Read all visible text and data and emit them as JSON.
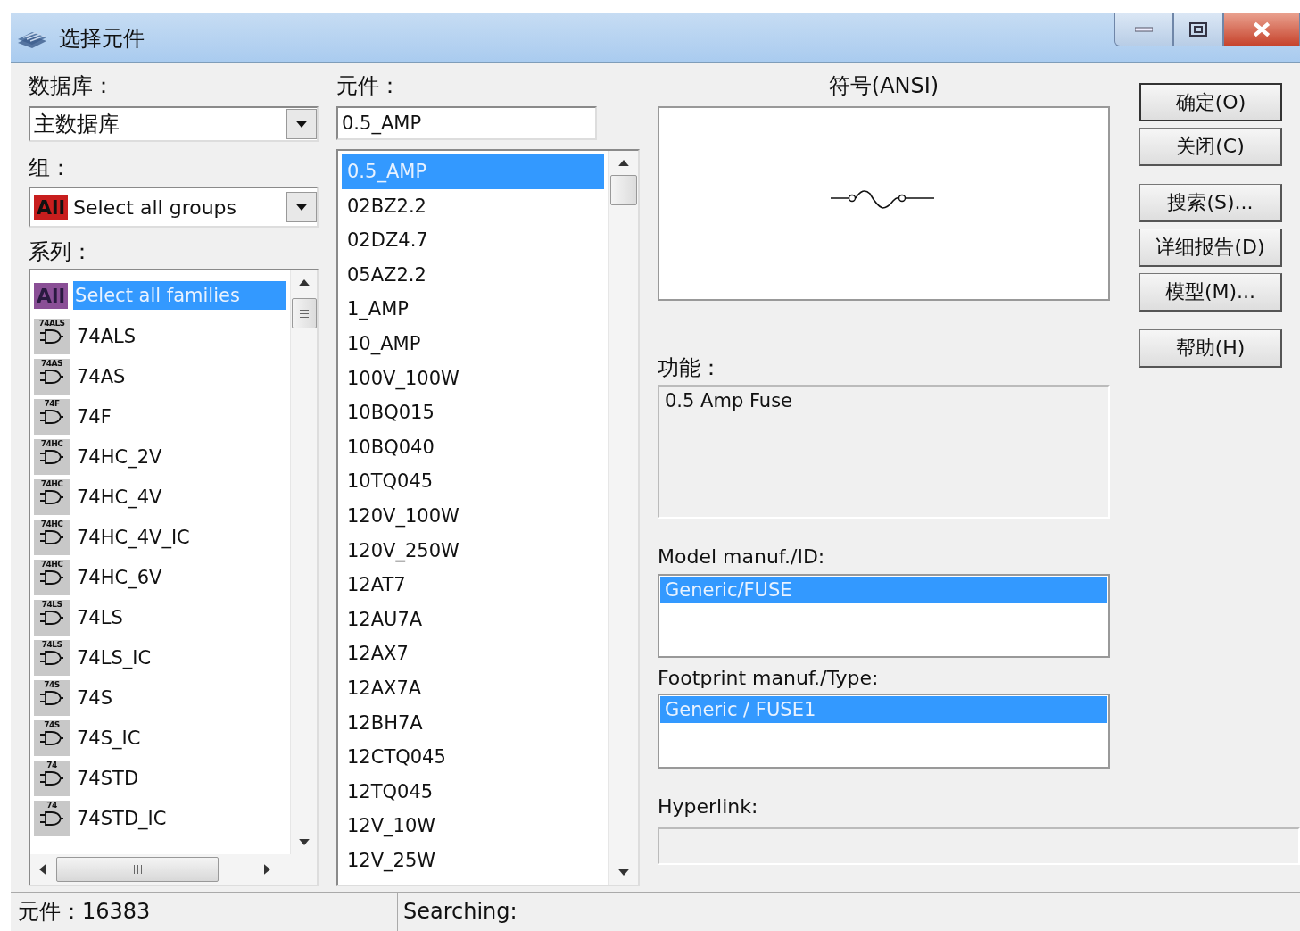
{
  "window": {
    "title": "选择元件"
  },
  "database": {
    "label": "数据库：",
    "value": "主数据库"
  },
  "group": {
    "label": "组：",
    "badge": "All",
    "value": "Select all groups"
  },
  "families": {
    "label": "系列：",
    "items": [
      {
        "kind": "all",
        "badge": "All",
        "name": "Select all families",
        "selected": true
      },
      {
        "kind": "gate",
        "icon_label": "74ALS",
        "name": "74ALS",
        "selected": false
      },
      {
        "kind": "gate",
        "icon_label": "74AS",
        "name": "74AS",
        "selected": false
      },
      {
        "kind": "gate",
        "icon_label": "74F",
        "name": "74F",
        "selected": false
      },
      {
        "kind": "gate",
        "icon_label": "74HC",
        "name": "74HC_2V",
        "selected": false
      },
      {
        "kind": "gate",
        "icon_label": "74HC",
        "name": "74HC_4V",
        "selected": false
      },
      {
        "kind": "gate",
        "icon_label": "74HC",
        "name": "74HC_4V_IC",
        "selected": false
      },
      {
        "kind": "gate",
        "icon_label": "74HC",
        "name": "74HC_6V",
        "selected": false
      },
      {
        "kind": "gate",
        "icon_label": "74LS",
        "name": "74LS",
        "selected": false
      },
      {
        "kind": "gate",
        "icon_label": "74LS",
        "name": "74LS_IC",
        "selected": false
      },
      {
        "kind": "gate",
        "icon_label": "74S",
        "name": "74S",
        "selected": false
      },
      {
        "kind": "gate",
        "icon_label": "74S",
        "name": "74S_IC",
        "selected": false
      },
      {
        "kind": "gate",
        "icon_label": "74",
        "name": "74STD",
        "selected": false
      },
      {
        "kind": "gate",
        "icon_label": "74",
        "name": "74STD_IC",
        "selected": false
      }
    ]
  },
  "components": {
    "label": "元件：",
    "value": "0.5_AMP",
    "items": [
      {
        "name": "0.5_AMP",
        "selected": true
      },
      {
        "name": "02BZ2.2",
        "selected": false
      },
      {
        "name": "02DZ4.7",
        "selected": false
      },
      {
        "name": "05AZ2.2",
        "selected": false
      },
      {
        "name": "1_AMP",
        "selected": false
      },
      {
        "name": "10_AMP",
        "selected": false
      },
      {
        "name": "100V_100W",
        "selected": false
      },
      {
        "name": "10BQ015",
        "selected": false
      },
      {
        "name": "10BQ040",
        "selected": false
      },
      {
        "name": "10TQ045",
        "selected": false
      },
      {
        "name": "120V_100W",
        "selected": false
      },
      {
        "name": "120V_250W",
        "selected": false
      },
      {
        "name": "12AT7",
        "selected": false
      },
      {
        "name": "12AU7A",
        "selected": false
      },
      {
        "name": "12AX7",
        "selected": false
      },
      {
        "name": "12AX7A",
        "selected": false
      },
      {
        "name": "12BH7A",
        "selected": false
      },
      {
        "name": "12CTQ045",
        "selected": false
      },
      {
        "name": "12TQ045",
        "selected": false
      },
      {
        "name": "12V_10W",
        "selected": false
      },
      {
        "name": "12V_25W",
        "selected": false
      }
    ]
  },
  "symbol": {
    "label": "符号(ANSI)"
  },
  "function": {
    "label": "功能：",
    "value": "0.5 Amp Fuse"
  },
  "model": {
    "label": "Model manuf./ID:",
    "items": [
      {
        "name": "Generic/FUSE",
        "selected": true
      }
    ]
  },
  "footprint": {
    "label": "Footprint manuf./Type:",
    "items": [
      {
        "name": "Generic / FUSE1",
        "selected": true
      }
    ]
  },
  "hyperlink": {
    "label": "Hyperlink:"
  },
  "buttons": [
    {
      "label": "确定(O)",
      "kind": "default"
    },
    {
      "label": "关闭(C)",
      "kind": "normal"
    },
    {
      "label": "搜索(S)...",
      "kind": "spaced"
    },
    {
      "label": "详细报告(D)",
      "kind": "normal"
    },
    {
      "label": "模型(M)...",
      "kind": "normal"
    },
    {
      "label": "帮助(H)",
      "kind": "spaced"
    }
  ],
  "status_bar": {
    "count": "元件：16383",
    "search": "Searching:"
  }
}
